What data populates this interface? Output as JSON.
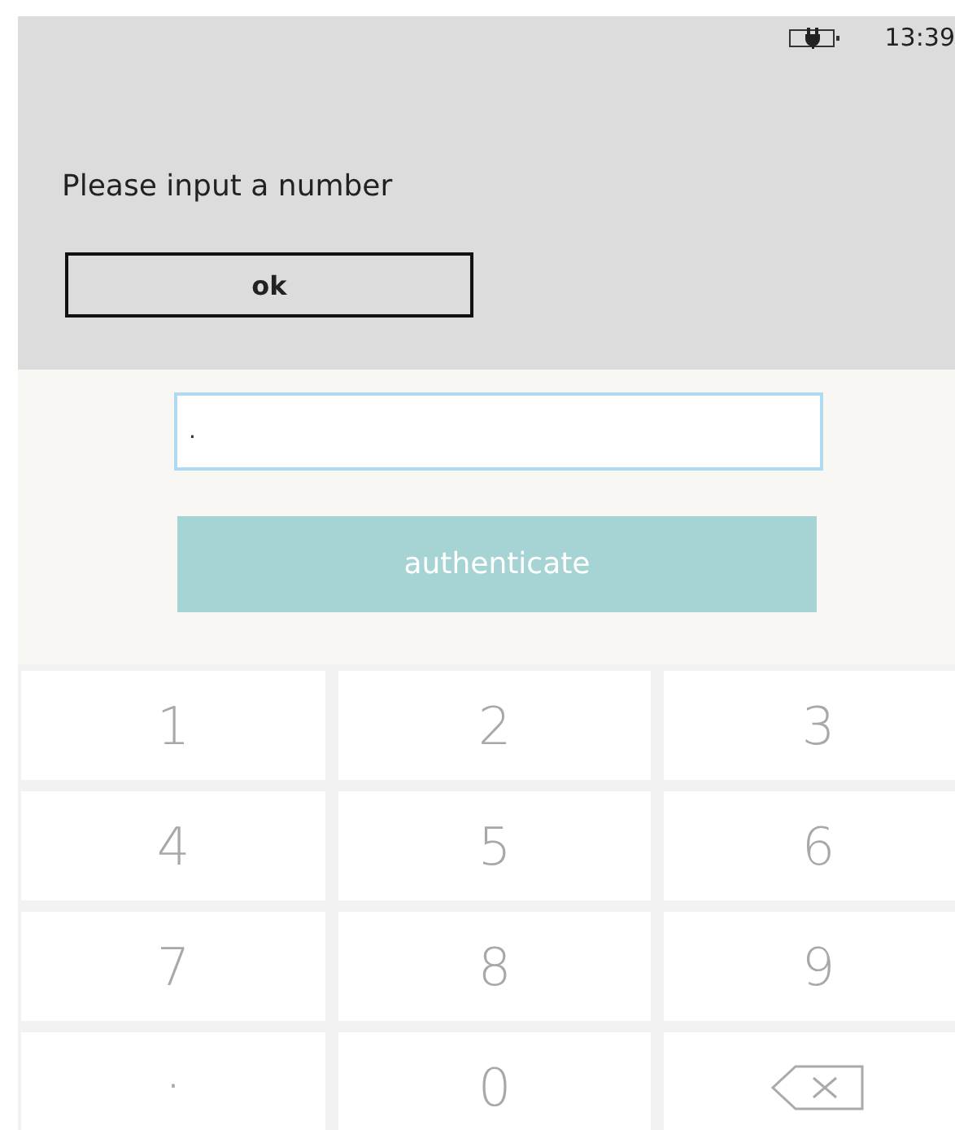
{
  "status_bar": {
    "charging": true,
    "time": "13:39"
  },
  "dialog": {
    "message": "Please input a number",
    "button": "ok"
  },
  "form": {
    "input_value": ".",
    "button": "authenticate",
    "button_disabled": true
  },
  "keypad": [
    {
      "kind": "digit",
      "label": "1"
    },
    {
      "kind": "digit",
      "label": "2"
    },
    {
      "kind": "digit",
      "label": "3"
    },
    {
      "kind": "digit",
      "label": "4"
    },
    {
      "kind": "digit",
      "label": "5"
    },
    {
      "kind": "digit",
      "label": "6"
    },
    {
      "kind": "digit",
      "label": "7"
    },
    {
      "kind": "digit",
      "label": "8"
    },
    {
      "kind": "digit",
      "label": "9"
    },
    {
      "kind": "point",
      "label": "."
    },
    {
      "kind": "digit",
      "label": "0"
    },
    {
      "kind": "backspace"
    }
  ]
}
